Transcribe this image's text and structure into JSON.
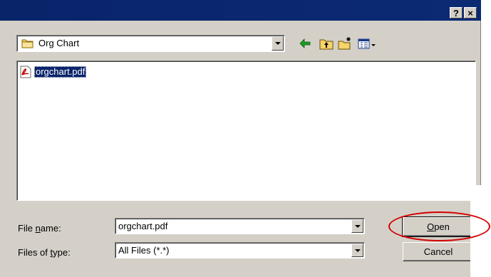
{
  "titlebar": {
    "help_label": "?",
    "close_label": "×"
  },
  "look_in": {
    "value": "Org Chart",
    "icon": "folder-icon"
  },
  "toolbar": {
    "icons": [
      "back-arrow-icon",
      "up-folder-icon",
      "new-folder-icon",
      "view-menu-icon"
    ]
  },
  "files": [
    {
      "name": "orgchart.pdf",
      "icon": "pdf-file-icon",
      "selected": true
    }
  ],
  "file_name": {
    "label_pre": "File ",
    "label_key": "n",
    "label_post": "ame:",
    "value": "orgchart.pdf"
  },
  "file_type": {
    "label_pre": "Files of ",
    "label_key": "t",
    "label_post": "ype:",
    "value": "All Files (*.*)"
  },
  "buttons": {
    "open_key": "O",
    "open_rest": "pen",
    "cancel": "Cancel"
  },
  "colors": {
    "title_bar": "#0a246a",
    "face": "#d4d0c8",
    "selection": "#0a246a",
    "highlight_ring": "#d40000"
  }
}
